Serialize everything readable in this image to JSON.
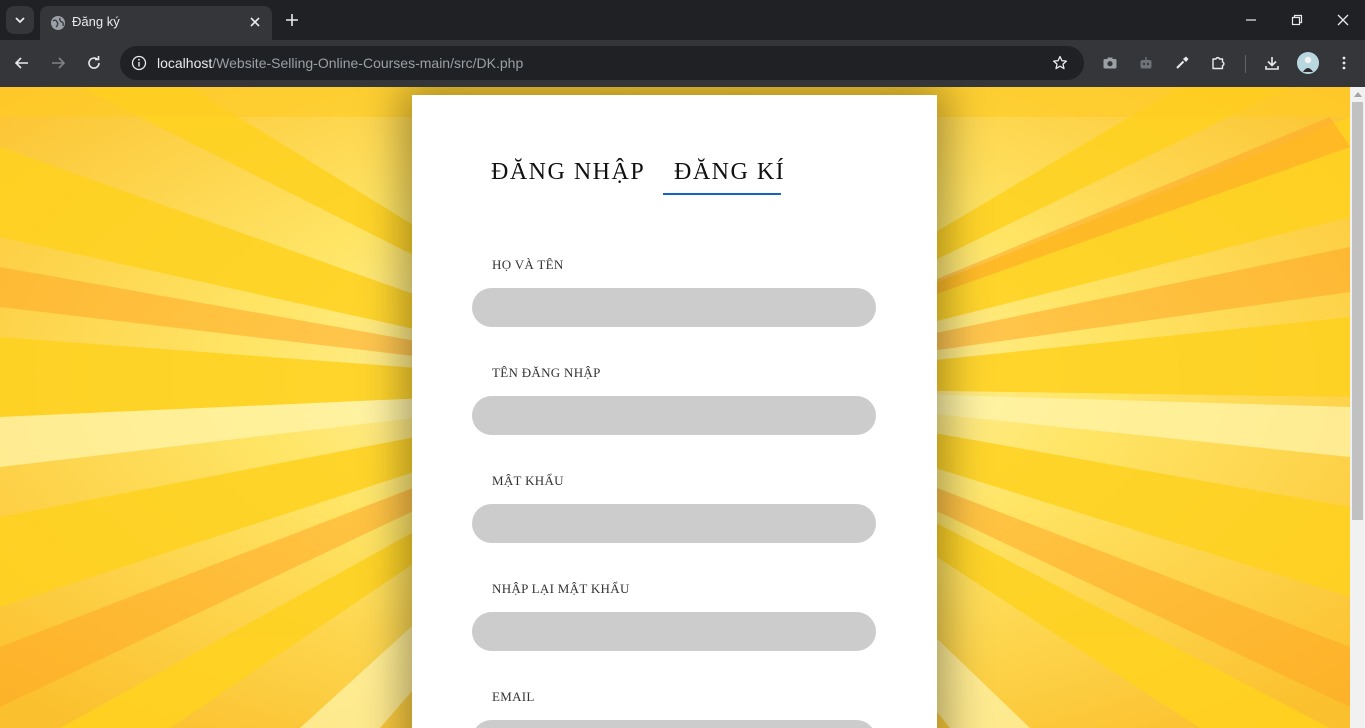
{
  "browser": {
    "tab_title": "Đăng ký",
    "url_host": "localhost",
    "url_path": "/Website-Selling-Online-Courses-main/src/DK.php"
  },
  "page": {
    "tabs": {
      "login": "ĐĂNG NHẬP",
      "register": "ĐĂNG KÍ",
      "active": "register"
    },
    "fields": [
      {
        "label": "HỌ VÀ TÊN",
        "value": ""
      },
      {
        "label": "TÊN ĐĂNG NHẬP",
        "value": ""
      },
      {
        "label": "MẬT KHẨU",
        "value": ""
      },
      {
        "label": "NHẬP LẠI MẬT KHẨU",
        "value": ""
      },
      {
        "label": "EMAIL",
        "value": ""
      }
    ]
  },
  "colors": {
    "accent_underline": "#1565c0",
    "input_bg": "#cccccc",
    "background": "#fdd835"
  }
}
